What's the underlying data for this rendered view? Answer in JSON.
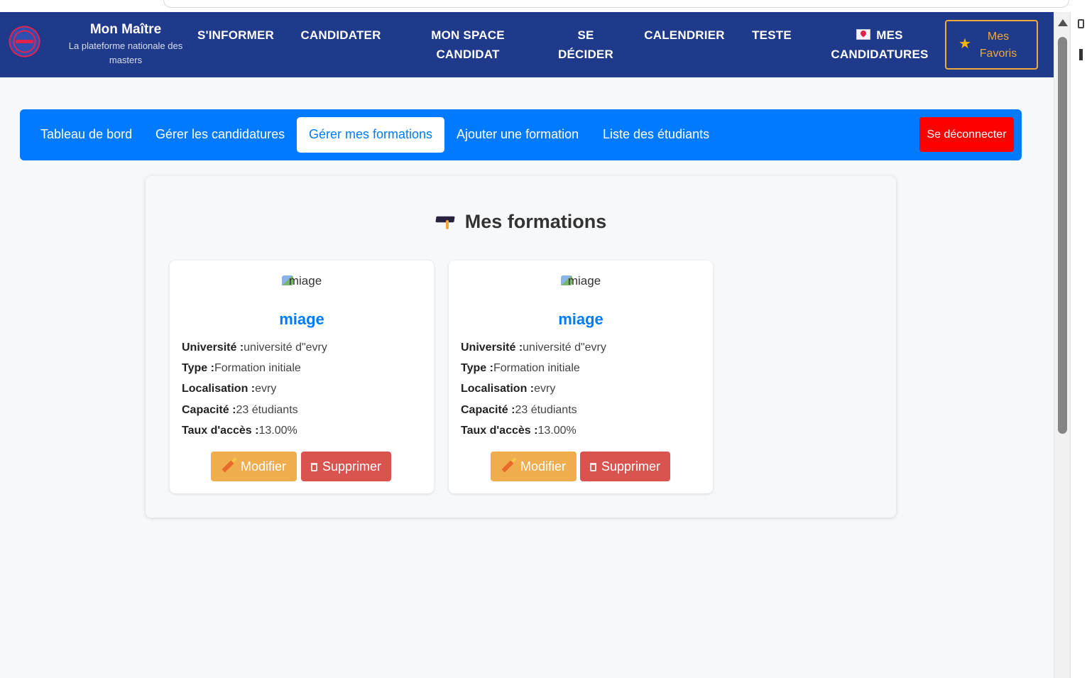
{
  "navbar": {
    "brand_title": "Mon Maître",
    "brand_subtitle": "La plateforme nationale des masters",
    "links": [
      {
        "line1": "S'INFORMER",
        "line2": ""
      },
      {
        "line1": "CANDIDATER",
        "line2": ""
      },
      {
        "line1": "MON SPACE",
        "line2": "CANDIDAT"
      },
      {
        "line1": "SE",
        "line2": "DÉCIDER"
      },
      {
        "line1": "CALENDRIER",
        "line2": ""
      },
      {
        "line1": "TESTE",
        "line2": ""
      },
      {
        "line1": "MES",
        "line2": "CANDIDATURES"
      }
    ],
    "favorites_line1": "Mes",
    "favorites_line2": "Favoris",
    "favorites_color": "#f0a93b"
  },
  "tabs": {
    "items": [
      {
        "label": "Tableau de bord",
        "active": false
      },
      {
        "label": "Gérer les candidatures",
        "active": false
      },
      {
        "label": "Gérer mes formations",
        "active": true
      },
      {
        "label": "Ajouter une formation",
        "active": false
      },
      {
        "label": "Liste des étudiants",
        "active": false
      }
    ],
    "logout_label": "Se déconnecter",
    "bar_color": "#007bff",
    "logout_color": "#ff0000"
  },
  "main": {
    "title": "Mes formations",
    "cards": [
      {
        "image_alt": "miage",
        "name": "miage",
        "university_label": "Université :",
        "university": "université d\"evry",
        "type_label": "Type :",
        "type": "Formation initiale",
        "location_label": "Localisation :",
        "location": "evry",
        "capacity_label": "Capacité :",
        "capacity": "23 étudiants",
        "rate_label": "Taux d'accès :",
        "rate": "13.00%",
        "edit_label": "Modifier",
        "delete_label": "Supprimer"
      },
      {
        "image_alt": "miage",
        "name": "miage",
        "university_label": "Université :",
        "university": "université d\"evry",
        "type_label": "Type :",
        "type": "Formation initiale",
        "location_label": "Localisation :",
        "location": "evry",
        "capacity_label": "Capacité :",
        "capacity": "23 étudiants",
        "rate_label": "Taux d'accès :",
        "rate": "13.00%",
        "edit_label": "Modifier",
        "delete_label": "Supprimer"
      }
    ]
  }
}
